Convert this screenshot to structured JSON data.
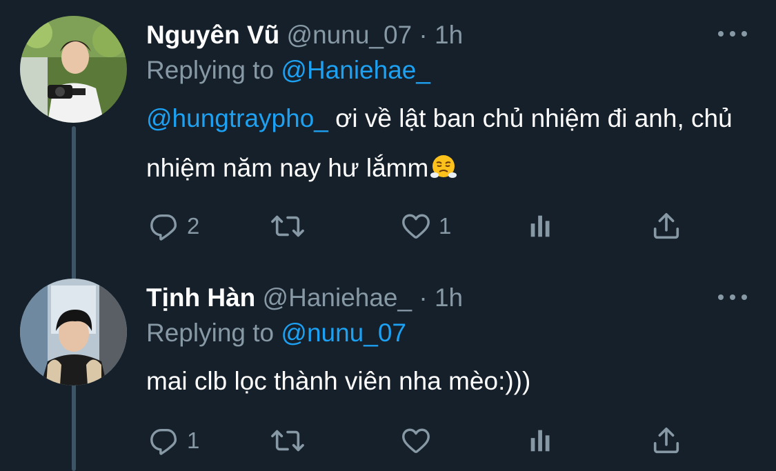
{
  "tweets": [
    {
      "display_name": "Nguyên Vũ",
      "handle": "@nunu_07",
      "separator": "·",
      "time": "1h",
      "replying_prefix": "Replying to",
      "replying_to": "@Haniehae_",
      "mention": "@hungtraypho_",
      "text": " ơi về lật ban chủ nhiệm đi anh, chủ nhiệm năm nay hư lắmm",
      "emoji": "face-with-steam-from-nose",
      "reply_count": "2",
      "retweet_count": "",
      "like_count": "1"
    },
    {
      "display_name": "Tịnh Hàn",
      "handle": "@Haniehae_",
      "separator": "·",
      "time": "1h",
      "replying_prefix": "Replying to",
      "replying_to": "@nunu_07",
      "mention": "",
      "text": "mai clb lọc thành viên nha mèo:)))",
      "reply_count": "1",
      "retweet_count": "",
      "like_count": ""
    }
  ],
  "icons": [
    "reply-icon",
    "retweet-icon",
    "like-icon",
    "analytics-icon",
    "share-icon",
    "more-icon"
  ],
  "colors": {
    "background": "#15202b",
    "link": "#1da1f2",
    "muted": "#8899a6",
    "thread_line": "#3d5466"
  }
}
